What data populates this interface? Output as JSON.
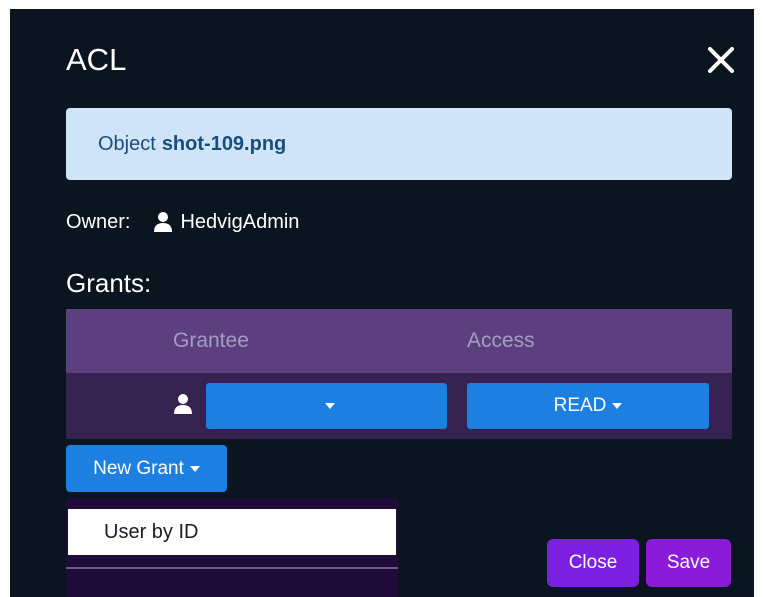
{
  "dialog": {
    "title": "ACL",
    "close_icon": "close-icon"
  },
  "object_info": {
    "prefix": "Object",
    "name": "shot-109.png"
  },
  "owner": {
    "label": "Owner:",
    "icon": "user-icon",
    "name": "HedvigAdmin"
  },
  "grants": {
    "label": "Grants:",
    "columns": [
      "Grantee",
      "Access"
    ],
    "rows": [
      {
        "icon": "user-icon",
        "grantee": "",
        "access": "READ"
      }
    ]
  },
  "new_grant": {
    "label": "New Grant",
    "menu_items": [
      "User by ID"
    ]
  },
  "footer": {
    "close_label": "Close",
    "save_label": "Save"
  },
  "colors": {
    "dialog_bg": "#0a1520",
    "info_bg": "#cfe5f7",
    "table_header_bg": "#5b3f7f",
    "table_row_bg": "#352251",
    "primary_blue": "#1d7fe0",
    "footer_purple": "#7b1fe0"
  }
}
